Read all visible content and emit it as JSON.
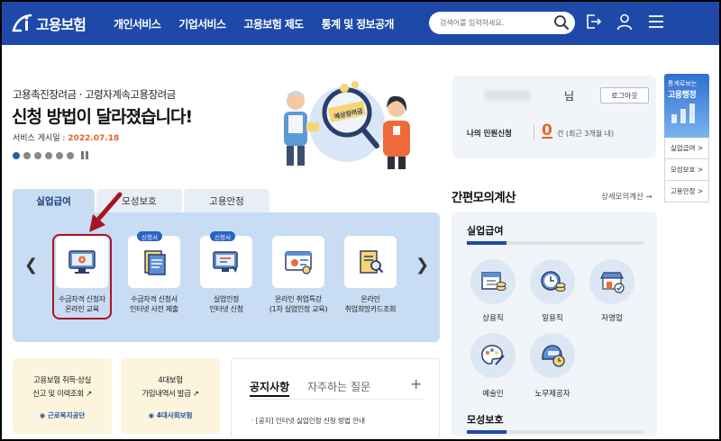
{
  "header": {
    "logo_text": "고용보험",
    "nav": [
      "개인서비스",
      "기업서비스",
      "고용보험 제도",
      "통계 및 정보공개"
    ],
    "search_placeholder": "검색어를 입력하세요.",
    "brand_color": "#1e49a8"
  },
  "banner": {
    "subtitle": "고용촉진장려금 · 고령자계속고용장려금",
    "title": "신청 방법이 달라졌습니다!",
    "date_label": "서비스 게시일 : ",
    "date_value": "2022.07.18",
    "illustration_sign": "예상장려금",
    "slides_total": 6,
    "slide_active": 1
  },
  "user": {
    "honorific": "님",
    "logout_label": "로그아웃",
    "petition_label": "나의 민원신청",
    "petition_count": "0",
    "petition_unit": "건 (최근 3개월 내)"
  },
  "quick_menu": {
    "top_line1": "통계로보는",
    "top_line2": "고용행정",
    "items": [
      "실업급여 >",
      "모성보호 >",
      "고용안정 >"
    ]
  },
  "tabs": [
    "실업급여",
    "모성보호",
    "고용안정"
  ],
  "services": [
    {
      "line1": "수급자격 신청자",
      "line2": "온라인 교육",
      "badge": ""
    },
    {
      "line1": "수급자격 신청서",
      "line2": "인터넷 사전 제출",
      "badge": "신청서"
    },
    {
      "line1": "실업인정",
      "line2": "인터넷 신청",
      "badge": "신청서"
    },
    {
      "line1": "온라인 취업특강",
      "line2": "(1차 실업인정 교육)",
      "badge": ""
    },
    {
      "line1": "온라인",
      "line2": "취업희망카드조회",
      "badge": ""
    }
  ],
  "calc": {
    "title": "간편모의계산",
    "more": "상세모의계산 →",
    "section1": "실업급여",
    "items": [
      "상용직",
      "일용직",
      "자영업",
      "예술인",
      "노무제공자"
    ],
    "section2": "모성보호"
  },
  "bottom_cards": [
    {
      "line1": "고용보험 취득·상실",
      "line2": "신고 및 이력조회",
      "org": "근로복지공단"
    },
    {
      "line1": "4대보험",
      "line2": "가입내역서 발급",
      "org": "4대사회보험"
    }
  ],
  "notice": {
    "tab1": "공지사항",
    "tab2": "자주하는 질문",
    "plus": "+",
    "items": [
      "[공지] 인터넷 실업인정 신청 방법 안내"
    ]
  }
}
